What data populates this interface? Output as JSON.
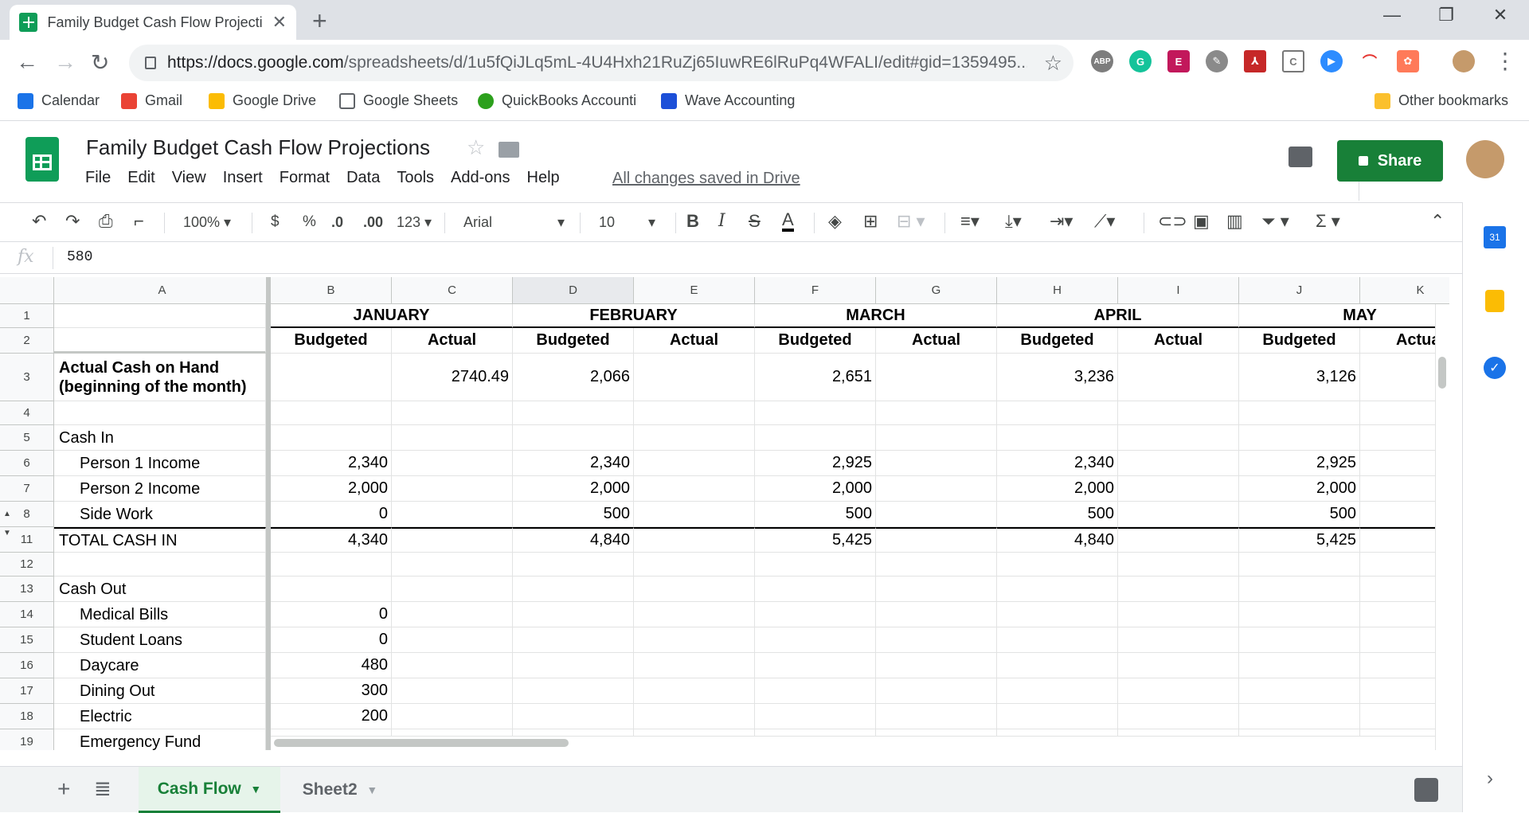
{
  "browser": {
    "tab_title": "Family Budget Cash Flow Projecti",
    "url_host": "https://docs.google.com",
    "url_path": "/spreadsheets/d/1u5fQiJLq5mL-4U4Hxh21RuZj65IuwRE6lRuPq4WFALI/edit#gid=1359495...",
    "bookmarks": [
      "Calendar",
      "Gmail",
      "Google Drive",
      "Google Sheets",
      "QuickBooks Accounti",
      "Wave Accounting"
    ],
    "other_bookmarks": "Other bookmarks"
  },
  "app": {
    "title": "Family Budget Cash Flow Projections",
    "menu": [
      "File",
      "Edit",
      "View",
      "Insert",
      "Format",
      "Data",
      "Tools",
      "Add-ons",
      "Help"
    ],
    "saved_status": "All changes saved in Drive",
    "share_label": "Share"
  },
  "toolbar": {
    "zoom": "100%",
    "currency": "$",
    "percent": "%",
    "dec_decrease": ".0",
    "dec_increase": ".00",
    "more_formats": "123",
    "font": "Arial",
    "font_size": "10"
  },
  "formula_bar": {
    "fx": "fx",
    "value": "580"
  },
  "grid": {
    "columns": [
      "A",
      "B",
      "C",
      "D",
      "E",
      "F",
      "G",
      "H",
      "I",
      "J",
      "K"
    ],
    "months": [
      "JANUARY",
      "FEBRUARY",
      "MARCH",
      "APRIL",
      "MAY"
    ],
    "subheaders": [
      "Budgeted",
      "Actual",
      "Budgeted",
      "Actual",
      "Budgeted",
      "Actual",
      "Budgeted",
      "Actual",
      "Budgeted",
      "Actual"
    ],
    "rows": [
      {
        "num": "1",
        "label": "",
        "values": [
          "",
          "",
          "",
          "",
          "",
          "",
          "",
          "",
          "",
          ""
        ]
      },
      {
        "num": "2",
        "label": "",
        "values": [
          "",
          "",
          "",
          "",
          "",
          "",
          "",
          "",
          "",
          ""
        ]
      },
      {
        "num": "3",
        "label": "Actual Cash on Hand",
        "label2": "(beginning of the month)",
        "values": [
          "",
          "2740.49",
          "2,066",
          "",
          "2,651",
          "",
          "3,236",
          "",
          "3,126",
          ""
        ]
      },
      {
        "num": "4",
        "label": "",
        "values": [
          "",
          "",
          "",
          "",
          "",
          "",
          "",
          "",
          "",
          ""
        ]
      },
      {
        "num": "5",
        "label": "Cash In",
        "values": [
          "",
          "",
          "",
          "",
          "",
          "",
          "",
          "",
          "",
          ""
        ]
      },
      {
        "num": "6",
        "label": "Person 1 Income",
        "values": [
          "2,340",
          "",
          "2,340",
          "",
          "2,925",
          "",
          "2,340",
          "",
          "2,925",
          ""
        ]
      },
      {
        "num": "7",
        "label": "Person 2 Income",
        "values": [
          "2,000",
          "",
          "2,000",
          "",
          "2,000",
          "",
          "2,000",
          "",
          "2,000",
          ""
        ]
      },
      {
        "num": "8",
        "label": "Side Work",
        "values": [
          "0",
          "",
          "500",
          "",
          "500",
          "",
          "500",
          "",
          "500",
          ""
        ]
      },
      {
        "num": "11",
        "label": "TOTAL CASH IN",
        "values": [
          "4,340",
          "",
          "4,840",
          "",
          "5,425",
          "",
          "4,840",
          "",
          "5,425",
          ""
        ]
      },
      {
        "num": "12",
        "label": "",
        "values": [
          "",
          "",
          "",
          "",
          "",
          "",
          "",
          "",
          "",
          ""
        ]
      },
      {
        "num": "13",
        "label": "Cash Out",
        "values": [
          "",
          "",
          "",
          "",
          "",
          "",
          "",
          "",
          "",
          ""
        ]
      },
      {
        "num": "14",
        "label": "Medical Bills",
        "values": [
          "0",
          "",
          "",
          "",
          "",
          "",
          "",
          "",
          "",
          ""
        ]
      },
      {
        "num": "15",
        "label": "Student Loans",
        "values": [
          "0",
          "",
          "",
          "",
          "",
          "",
          "",
          "",
          "",
          ""
        ]
      },
      {
        "num": "16",
        "label": "Daycare",
        "values": [
          "480",
          "",
          "",
          "",
          "",
          "",
          "",
          "",
          "",
          ""
        ]
      },
      {
        "num": "17",
        "label": "Dining Out",
        "values": [
          "300",
          "",
          "",
          "",
          "",
          "",
          "",
          "",
          "",
          ""
        ]
      },
      {
        "num": "18",
        "label": "Electric",
        "values": [
          "200",
          "",
          "",
          "",
          "",
          "",
          "",
          "",
          "",
          ""
        ]
      },
      {
        "num": "19",
        "label": "Emergency Fund",
        "values": [
          "",
          "",
          "",
          "",
          "",
          "",
          "",
          "",
          "",
          ""
        ]
      }
    ]
  },
  "sheets": {
    "active": "Cash Flow",
    "other": "Sheet2"
  },
  "colors": {
    "green": "#188038",
    "sheets_green": "#0f9d58"
  }
}
